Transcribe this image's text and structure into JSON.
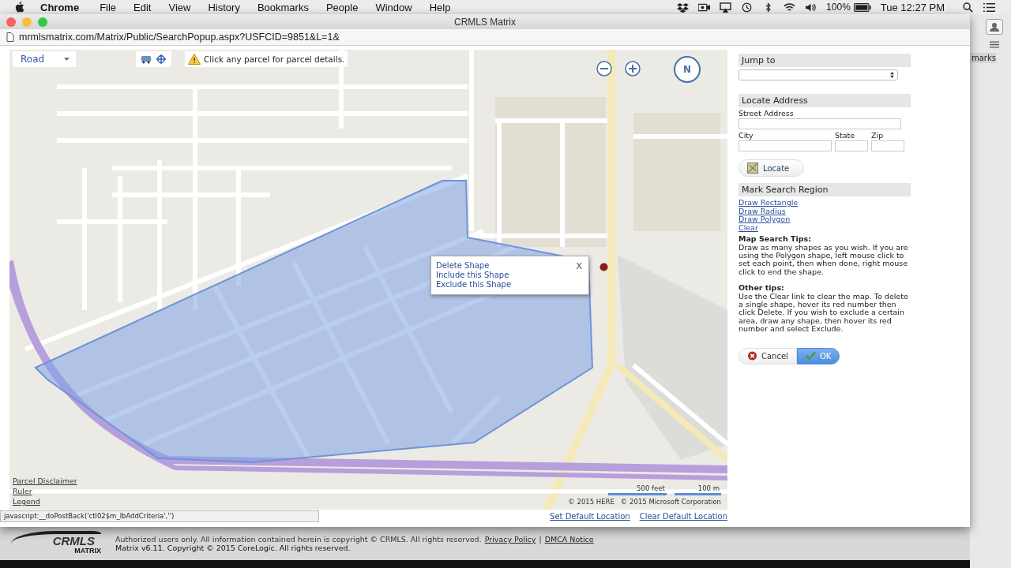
{
  "menubar": {
    "app": "Chrome",
    "menus": [
      "File",
      "Edit",
      "View",
      "History",
      "Bookmarks",
      "People",
      "Window",
      "Help"
    ],
    "battery": "100%",
    "clock": "Tue 12:27 PM"
  },
  "window": {
    "title": "CRMLS Matrix",
    "url": "mrmlsmatrix.com/Matrix/Public/SearchPopup.aspx?USFCID=9851&L=1&"
  },
  "map": {
    "map_type": "Road",
    "notice": "Click any parcel for parcel details.",
    "compass": "N",
    "popup": {
      "close": "X",
      "actions": [
        "Delete Shape",
        "Include this Shape",
        "Exclude this Shape"
      ]
    },
    "links": [
      "Parcel Disclaimer",
      "Ruler",
      "Legend"
    ],
    "scale": [
      "500 feet",
      "100 m"
    ],
    "credits": [
      "© 2015 HERE",
      "© 2015 Microsoft Corporation"
    ]
  },
  "status_url": "javascript:__doPostBack('ctl02$m_lbAddCriteria','')",
  "location_links": [
    "Set Default Location",
    "Clear Default Location"
  ],
  "panel": {
    "jump_to": {
      "title": "Jump to"
    },
    "locate": {
      "title": "Locate Address",
      "fields": [
        {
          "label": "Street Address"
        },
        {
          "label": "City"
        },
        {
          "label": "State"
        },
        {
          "label": "Zip"
        }
      ],
      "button": "Locate"
    },
    "mark": {
      "title": "Mark Search Region",
      "links": [
        "Draw Rectangle",
        "Draw Radius",
        "Draw Polygon",
        "Clear"
      ]
    },
    "tips": [
      {
        "title": "Map Search Tips:",
        "text": "Draw as many shapes as you wish. If you are using the Polygon shape, left mouse click to set each point, then when done, right mouse click to end the shape."
      },
      {
        "title": "Other tips:",
        "text": "Use the Clear link to clear the map. To delete a single shape, hover its red number then click Delete. If you wish to exclude a certain area, draw any shape, then hover its red number and select Exclude."
      }
    ],
    "buttons": [
      {
        "label": "Cancel",
        "kind": "cancel"
      },
      {
        "label": "OK",
        "kind": "ok"
      }
    ]
  },
  "background_window": {
    "text": "marks"
  },
  "footer": {
    "logo": "CRMLS",
    "logo_sub": "MATRIX",
    "notice": "Authorized users only. All information contained herein is copyright © CRMLS. All rights reserved.",
    "links": [
      "Privacy Policy",
      "DMCA Notice"
    ],
    "separator": "|",
    "copyright": "Matrix v6.11. Copyright © 2015 CoreLogic. All rights reserved."
  }
}
